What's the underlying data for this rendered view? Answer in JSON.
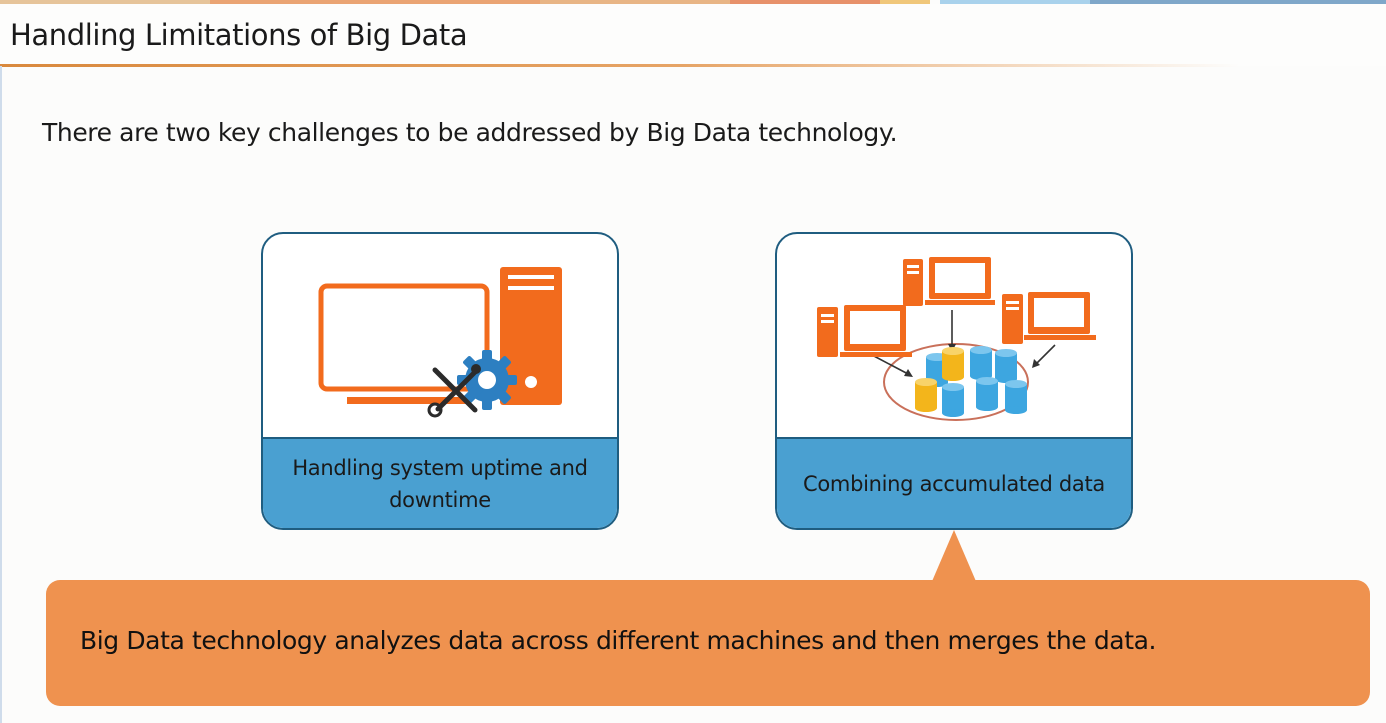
{
  "header": {
    "title": "Handling Limitations of Big Data"
  },
  "intro": {
    "text": "There are two key challenges to be addressed by Big Data technology."
  },
  "cards": [
    {
      "label": "Handling system uptime and downtime",
      "icon": "computer-repair-icon"
    },
    {
      "label": "Combining accumulated data",
      "icon": "distributed-data-icon"
    }
  ],
  "callout": {
    "text": "Big Data technology analyzes data across different machines and then merges the data."
  },
  "colors": {
    "accent_orange": "#f26b1d",
    "card_label_blue": "#4aa0d1",
    "card_border": "#1f5d80",
    "callout_orange": "#ef924f",
    "gear_blue": "#2d7fc1",
    "db_blue": "#3da6e0",
    "db_yellow": "#f3b51b"
  }
}
